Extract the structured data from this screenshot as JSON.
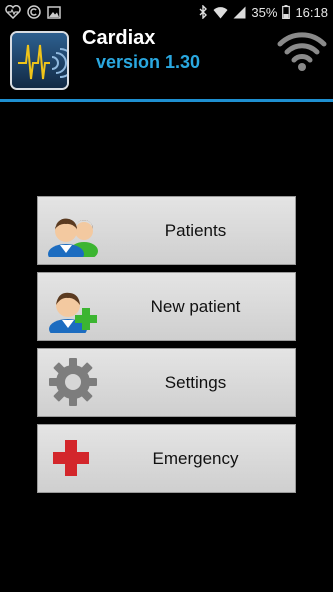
{
  "status_bar": {
    "battery": "35%",
    "time": "16:18",
    "left_icons": [
      "heart-rate-icon",
      "copyright-icon",
      "image-icon"
    ],
    "right_icons": [
      "bluetooth-icon",
      "wifi-signal-icon",
      "cell-signal-icon",
      "battery-icon"
    ]
  },
  "header": {
    "title": "Cardiax",
    "version": "version 1.30",
    "logo_icon": "ecg-logo-icon",
    "connection_icon": "wifi-icon"
  },
  "menu": {
    "items": [
      {
        "label": "Patients",
        "icon": "patients-icon"
      },
      {
        "label": "New patient",
        "icon": "add-patient-icon"
      },
      {
        "label": "Settings",
        "icon": "gear-icon"
      },
      {
        "label": "Emergency",
        "icon": "red-cross-icon"
      }
    ]
  },
  "colors": {
    "accent": "#1e8fd0",
    "version_text": "#2aa8e0",
    "emergency_red": "#d3262b",
    "add_green": "#3cb531"
  }
}
